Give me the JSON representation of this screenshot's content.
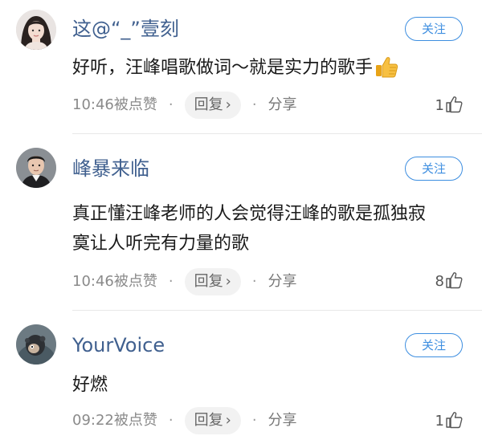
{
  "follow_label": "关注",
  "comments": [
    {
      "username": "这@“_”壹刻",
      "content": "好听，汪峰唱歌做词～就是实力的歌手",
      "emoji": "thumbs-up-icon",
      "time": "10:46被点赞",
      "reply_label": "回复",
      "share_label": "分享",
      "likes": "1"
    },
    {
      "username": "峰暴来临",
      "content_line1": "真正懂汪峰老师的人会觉得汪峰的歌是孤独寂",
      "content_line2": "寞让人听完有力量的歌",
      "time": "10:46被点赞",
      "reply_label": "回复",
      "share_label": "分享",
      "likes": "8"
    },
    {
      "username": "YourVoice",
      "content": "好燃",
      "time": "09:22被点赞",
      "reply_label": "回复",
      "share_label": "分享",
      "likes": "1"
    }
  ],
  "colors": {
    "username": "#40608f",
    "follow_accent": "#3d8ee0",
    "meta": "#8a8a8a"
  }
}
